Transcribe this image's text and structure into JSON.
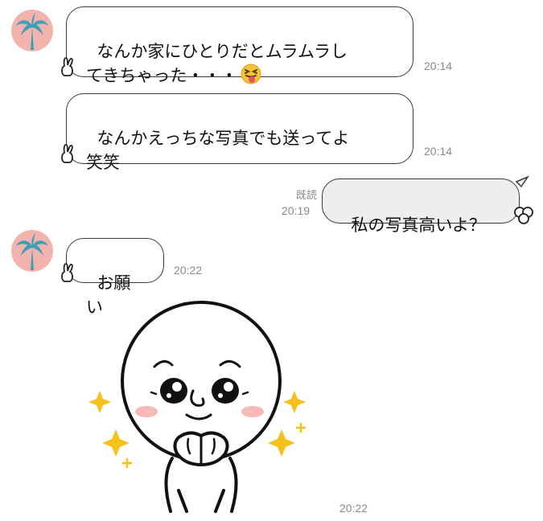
{
  "chat": {
    "messages": [
      {
        "text": "なんか家にひとりだとムラムラし\nてきちゃった・・・",
        "emoji": "squinting-tongue-face",
        "time": "20:14"
      },
      {
        "text": "なんかえっちな写真でも送ってよ\n笑笑",
        "time": "20:14"
      },
      {
        "text": "私の写真高いよ？",
        "read": "既読",
        "time": "20:19"
      },
      {
        "text": "お願い",
        "time": "20:22"
      },
      {
        "sticker": "moon-character-pleading-sticker",
        "time": "20:22"
      }
    ]
  },
  "colors": {
    "avatar_bg": "#f2b3ad",
    "palm": "#3b9fb6",
    "outgoing_bubble": "#eeeeee",
    "sparkle": "#f5c21b",
    "blush": "#f7b8b8"
  }
}
